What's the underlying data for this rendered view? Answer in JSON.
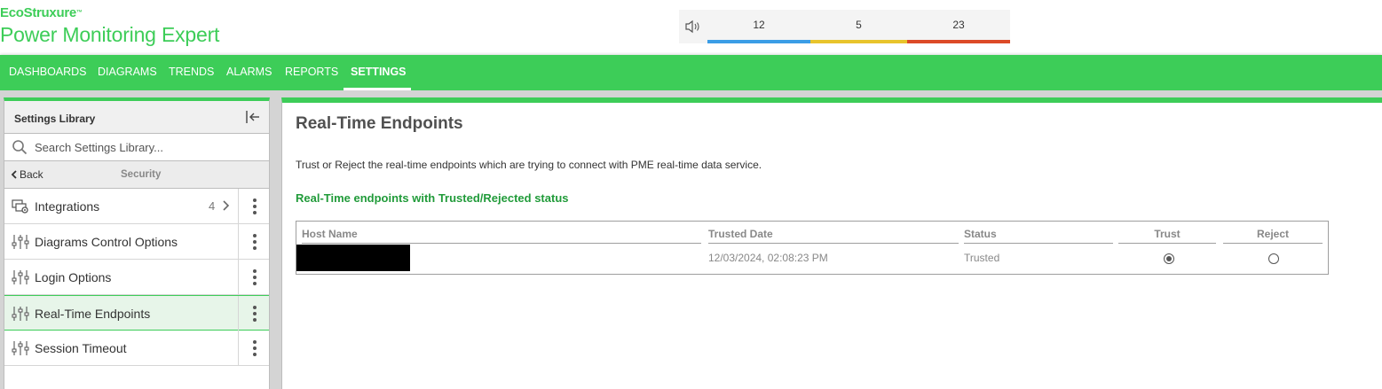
{
  "brand": {
    "name": "EcoStruxure",
    "tm": "™",
    "product": "Power Monitoring Expert"
  },
  "alarms": {
    "counts": [
      "12",
      "5",
      "23"
    ],
    "colors": [
      "#3b9de6",
      "#e8c42c",
      "#dc4a27"
    ]
  },
  "nav": {
    "items": [
      {
        "label": "DASHBOARDS"
      },
      {
        "label": "DIAGRAMS"
      },
      {
        "label": "TRENDS"
      },
      {
        "label": "ALARMS"
      },
      {
        "label": "REPORTS"
      },
      {
        "label": "SETTINGS",
        "active": true
      }
    ]
  },
  "library": {
    "title": "Settings Library",
    "search_placeholder": "Search Settings Library...",
    "back_label": "Back",
    "section": "Security",
    "items": [
      {
        "label": "Integrations",
        "count": "4",
        "icon": "integrations-icon"
      },
      {
        "label": "Diagrams Control Options",
        "icon": "sliders-icon"
      },
      {
        "label": "Login Options",
        "icon": "sliders-icon"
      },
      {
        "label": "Real-Time Endpoints",
        "icon": "sliders-icon",
        "selected": true
      },
      {
        "label": "Session Timeout",
        "icon": "sliders-icon"
      }
    ]
  },
  "main": {
    "title": "Real-Time Endpoints",
    "description": "Trust or Reject the real-time endpoints which are trying to connect with PME real-time data service.",
    "subheading": "Real-Time endpoints with Trusted/Rejected status",
    "table": {
      "columns": [
        "Host Name",
        "Trusted Date",
        "Status",
        "Trust",
        "Reject"
      ],
      "rows": [
        {
          "host": "",
          "trusted_date": "12/03/2024, 02:08:23 PM",
          "status": "Trusted",
          "trust": true,
          "reject": false
        }
      ]
    }
  },
  "colors": {
    "brand_green": "#3dcd58",
    "heading_green": "#219b3a"
  }
}
